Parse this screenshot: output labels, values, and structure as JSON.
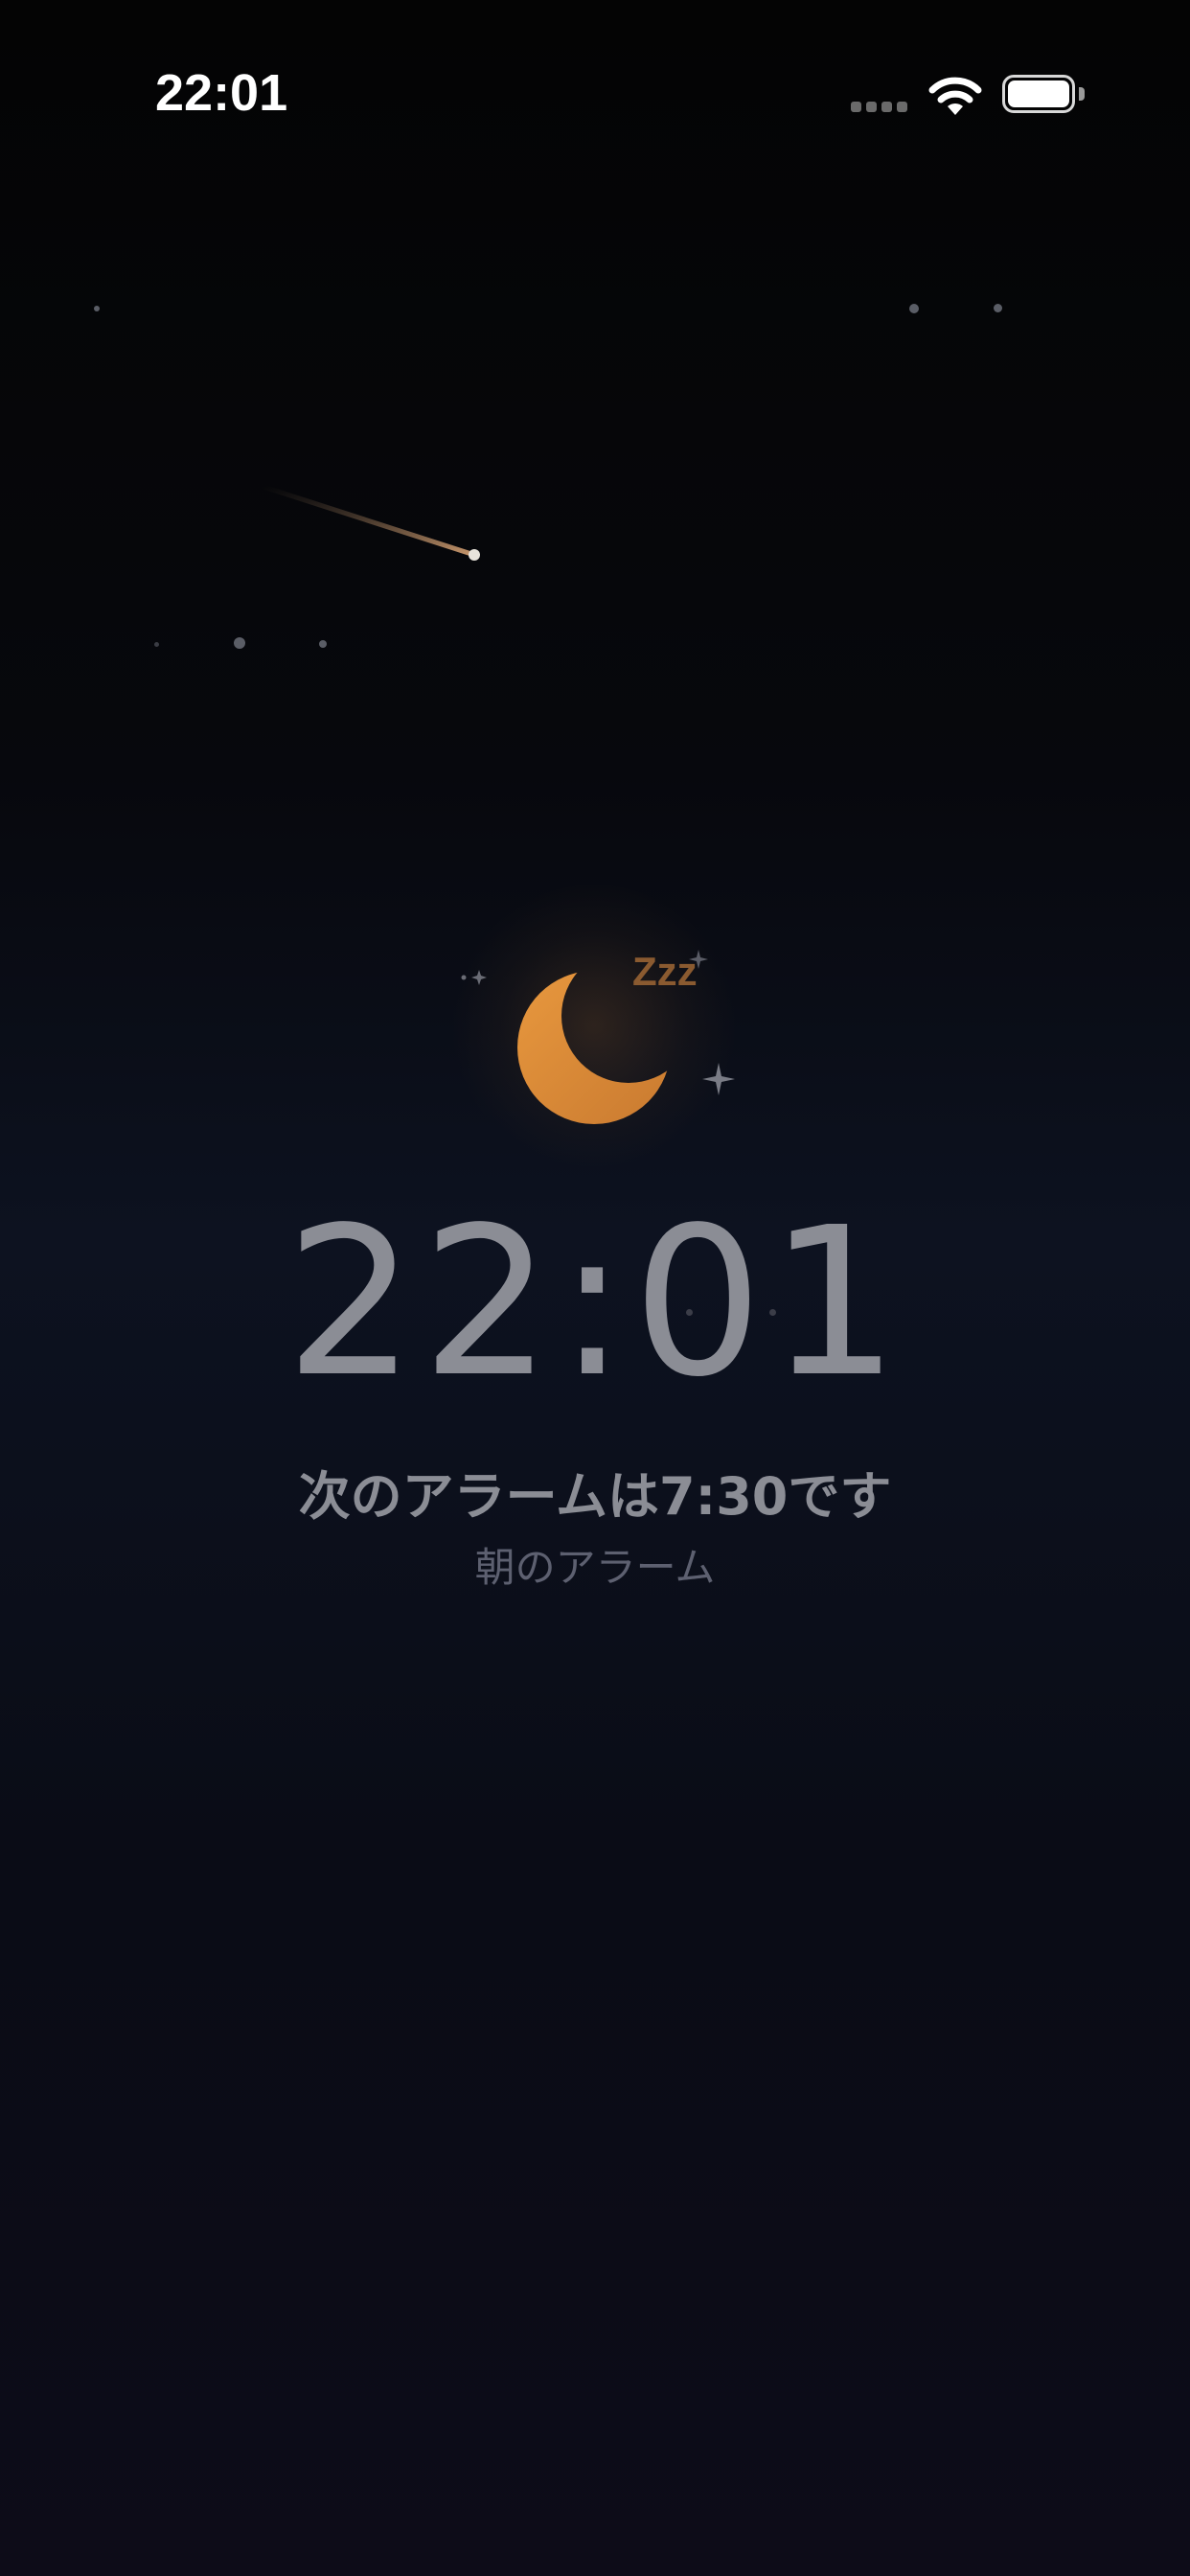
{
  "status_bar": {
    "time": "22:01",
    "signal_icon": "cellular-signal-icon",
    "wifi_icon": "wifi-icon",
    "battery_icon": "battery-full-icon"
  },
  "sleep_screen": {
    "moon_icon": "crescent-moon-icon",
    "zzz": "Zzz",
    "clock": "22:01",
    "next_alarm_text": "次のアラームは7:30です",
    "alarm_label": "朝のアラーム"
  },
  "colors": {
    "moon": "#e08e3c",
    "text": "#8b8d95",
    "subtext": "#5d6070",
    "zzz": "#8a5a30"
  }
}
